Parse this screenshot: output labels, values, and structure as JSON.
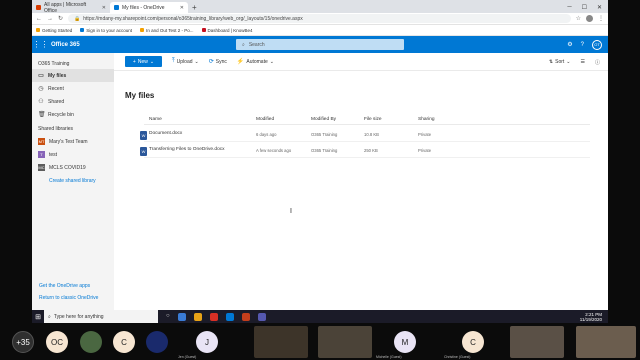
{
  "browser": {
    "tabs": [
      {
        "title": "All apps | Microsoft Office"
      },
      {
        "title": "My files - OneDrive"
      }
    ],
    "new_tab": "+",
    "url": "https://mdany-my.sharepoint.com/personal/o365training_library/web_org/_layouts/15/onedrive.aspx",
    "bookmarks": [
      "Getting Started",
      "Sign in to your account",
      "In and Out Test 2 - Po...",
      "Dashboard | KnowBe4"
    ]
  },
  "suite": {
    "brand": "Office 365",
    "search_placeholder": "Search",
    "avatar": "OT"
  },
  "leftnav": {
    "title": "O365 Training",
    "items": [
      {
        "label": "My files",
        "icon": "folder-icon"
      },
      {
        "label": "Recent",
        "icon": "clock-icon"
      },
      {
        "label": "Shared",
        "icon": "people-icon"
      },
      {
        "label": "Recycle bin",
        "icon": "trash-icon"
      }
    ],
    "shared_heading": "Shared libraries",
    "libraries": [
      {
        "label": "Mary's Test Team",
        "color": "#ca5010",
        "initials": "MT"
      },
      {
        "label": "test",
        "color": "#8764b8",
        "initials": "T"
      },
      {
        "label": "MCLS COVID19",
        "color": "#5c5c5c",
        "initials": "MC"
      }
    ],
    "create_link": "Create shared library",
    "bottom_links": [
      "Get the OneDrive apps",
      "Return to classic OneDrive"
    ]
  },
  "commands": {
    "new": "New",
    "upload": "Upload",
    "sync": "Sync",
    "automate": "Automate",
    "sort": "Sort"
  },
  "main": {
    "title": "My files",
    "columns": [
      "Name",
      "Modified",
      "Modified By",
      "File size",
      "Sharing"
    ],
    "rows": [
      {
        "name": "Document.docx",
        "modified": "6 days ago",
        "modified_by": "O365 Training",
        "size": "10.8 KB",
        "sharing": "Private"
      },
      {
        "name": "Transferring Files to OneDrive.docx",
        "modified": "A few seconds ago",
        "modified_by": "O365 Training",
        "size": "250 KB",
        "sharing": "Private"
      }
    ]
  },
  "taskbar": {
    "search": "Type here for anything",
    "time": "2:21 PM",
    "date": "11/19/2020"
  },
  "meeting": {
    "overflow": "+35",
    "participants": [
      {
        "initials": "OC",
        "color": "#f7e6d2"
      },
      {
        "initials": "C",
        "color": "#f7e6d2"
      },
      {
        "initials": "J",
        "color": "#e9e4f5",
        "name": "Jen (Guest)"
      },
      {
        "initials": "M",
        "color": "#e9e4f5",
        "name": "Michelle (Guest)"
      },
      {
        "initials": "C",
        "color": "#f7e6d2",
        "name": "Christine (Guest)"
      }
    ]
  },
  "colors": {
    "accent": "#0078d4",
    "nav_bg": "#f4f4f4"
  }
}
